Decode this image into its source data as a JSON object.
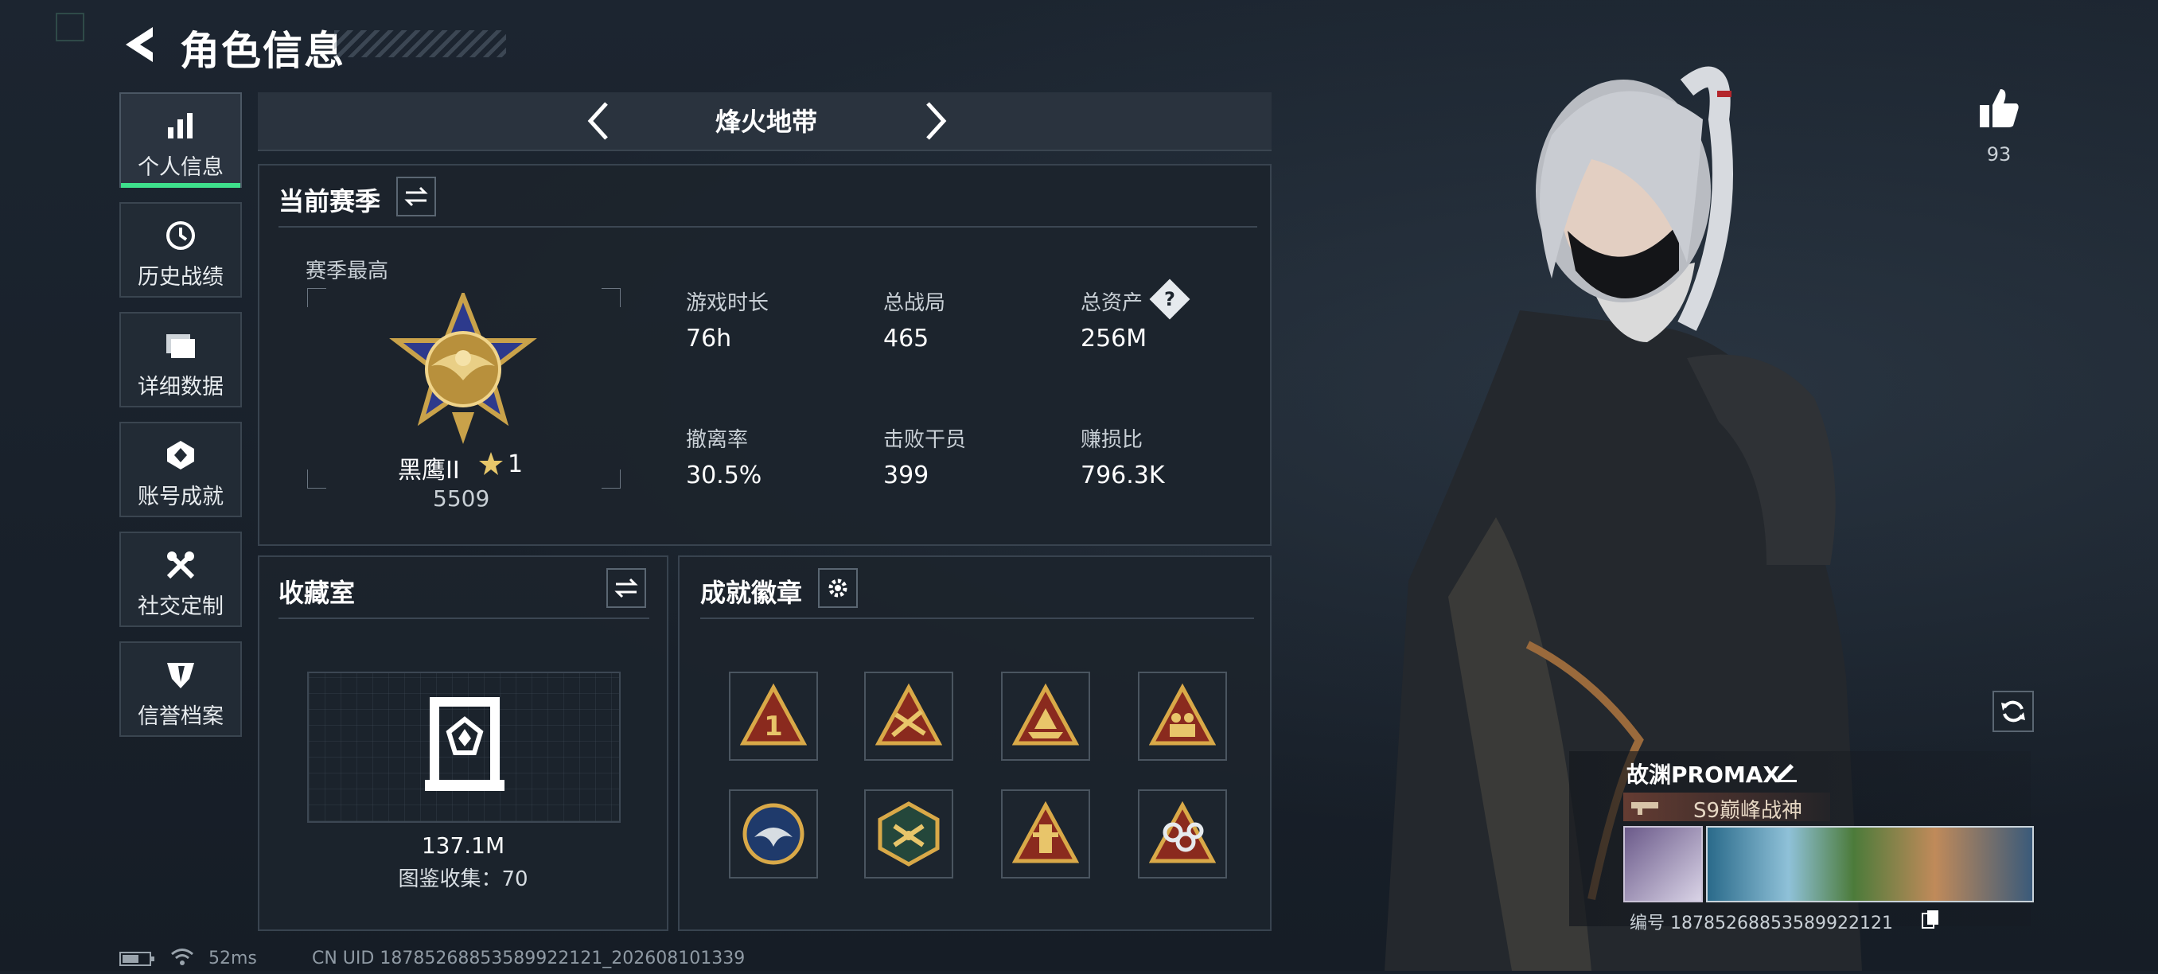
{
  "header": {
    "title": "角色信息"
  },
  "sidebar": {
    "items": [
      {
        "label": "个人信息",
        "icon": "bar-chart-icon",
        "active": true
      },
      {
        "label": "历史战绩",
        "icon": "clock-history-icon",
        "active": false
      },
      {
        "label": "详细数据",
        "icon": "folder-icon",
        "active": false
      },
      {
        "label": "账号成就",
        "icon": "achievement-icon",
        "active": false
      },
      {
        "label": "社交定制",
        "icon": "tools-icon",
        "active": false
      },
      {
        "label": "信誉档案",
        "icon": "reputation-shield-icon",
        "active": false
      }
    ]
  },
  "mode_selector": {
    "current": "烽火地带"
  },
  "season": {
    "title": "当前赛季",
    "best_label": "赛季最高",
    "rank_name": "黑鹰II",
    "rank_stars": "1",
    "rank_score": "5509",
    "stats": [
      {
        "label": "游戏时长",
        "value": "76h"
      },
      {
        "label": "总战局",
        "value": "465"
      },
      {
        "label": "总资产",
        "value": "256M"
      },
      {
        "label": "撤离率",
        "value": "30.5%"
      },
      {
        "label": "击败干员",
        "value": "399"
      },
      {
        "label": "赚损比",
        "value": "796.3K"
      }
    ],
    "help_symbol": "?"
  },
  "collection": {
    "title": "收藏室",
    "value": "137.1M",
    "collected_text": "图鉴收集：70"
  },
  "achievements": {
    "title": "成就徽章",
    "badges": [
      "rank-1-badge-icon",
      "crossed-guns-badge-icon",
      "ship-badge-icon",
      "squad-badge-icon",
      "eagle-badge-icon",
      "dragonfly-badge-icon",
      "tower-badge-icon",
      "chain-badge-icon"
    ]
  },
  "profile": {
    "likes": "93",
    "player_name": "故渊PROMAX",
    "player_title": "S9巅峰战神",
    "id_text": "编号 18785268853589922121"
  },
  "status_bar": {
    "ping": "52ms",
    "uid_text": "CN UID 18785268853589922121_202608101339"
  },
  "colors": {
    "accent_green": "#3ee08c",
    "gold": "#c9a24a",
    "panel_border": "#38434f"
  }
}
